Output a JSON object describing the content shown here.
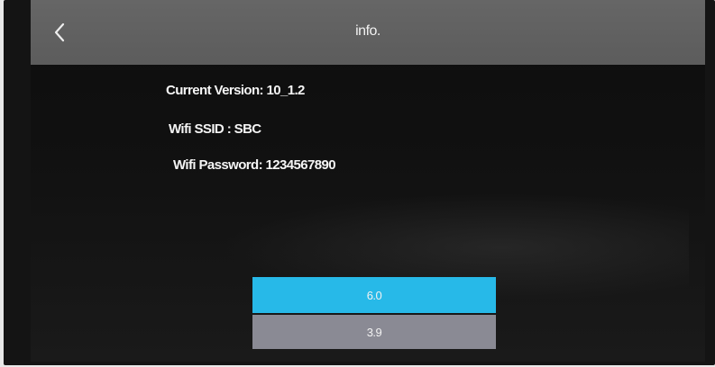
{
  "header": {
    "title": "info.",
    "back_icon": "chevron-left-icon"
  },
  "info": {
    "current_version": "Current Version: 10_1.2",
    "wifi_ssid": "Wifi SSID : SBC",
    "wifi_password": "Wifi Password: 1234567890"
  },
  "options": [
    {
      "label": "6.0",
      "color": "#27b9e8"
    },
    {
      "label": "3.9",
      "color": "#8a8a94"
    }
  ],
  "colors": {
    "header_bg": "#606060",
    "screen_bg": "#111111",
    "accent": "#27b9e8"
  }
}
